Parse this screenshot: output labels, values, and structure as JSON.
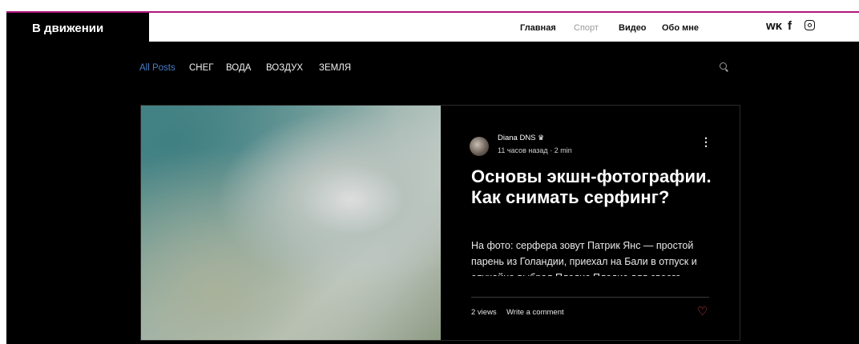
{
  "site": {
    "brand": "В движении"
  },
  "nav": {
    "items": [
      "Главная",
      "Спорт",
      "Видео",
      "Обо мне"
    ],
    "active": "Спорт"
  },
  "social": {
    "vk": "ᴡᴋ",
    "facebook": "f",
    "instagram_icon": "instagram-icon"
  },
  "categories": {
    "items": [
      "All Posts",
      "СНЕГ",
      "ВОДА",
      "ВОЗДУХ",
      "ЗЕМЛЯ"
    ],
    "active": "All Posts"
  },
  "post": {
    "author": "Diana DNS",
    "time": "11 часов назад",
    "read_time": "2 min",
    "title": "Основы экшн-фотографии. Как снимать серфинг?",
    "excerpt": "На фото: серфера зовут Патрик Янс — простой парень из Голандии, приехал на Бали в отпуск и случайно выбрал Пледис Пледис для своего",
    "views": "2 views",
    "comment": "Write a comment"
  },
  "colors": {
    "accent_line": "#b0157a",
    "active_category": "#4a7cc7",
    "heart": "#e5484d"
  }
}
